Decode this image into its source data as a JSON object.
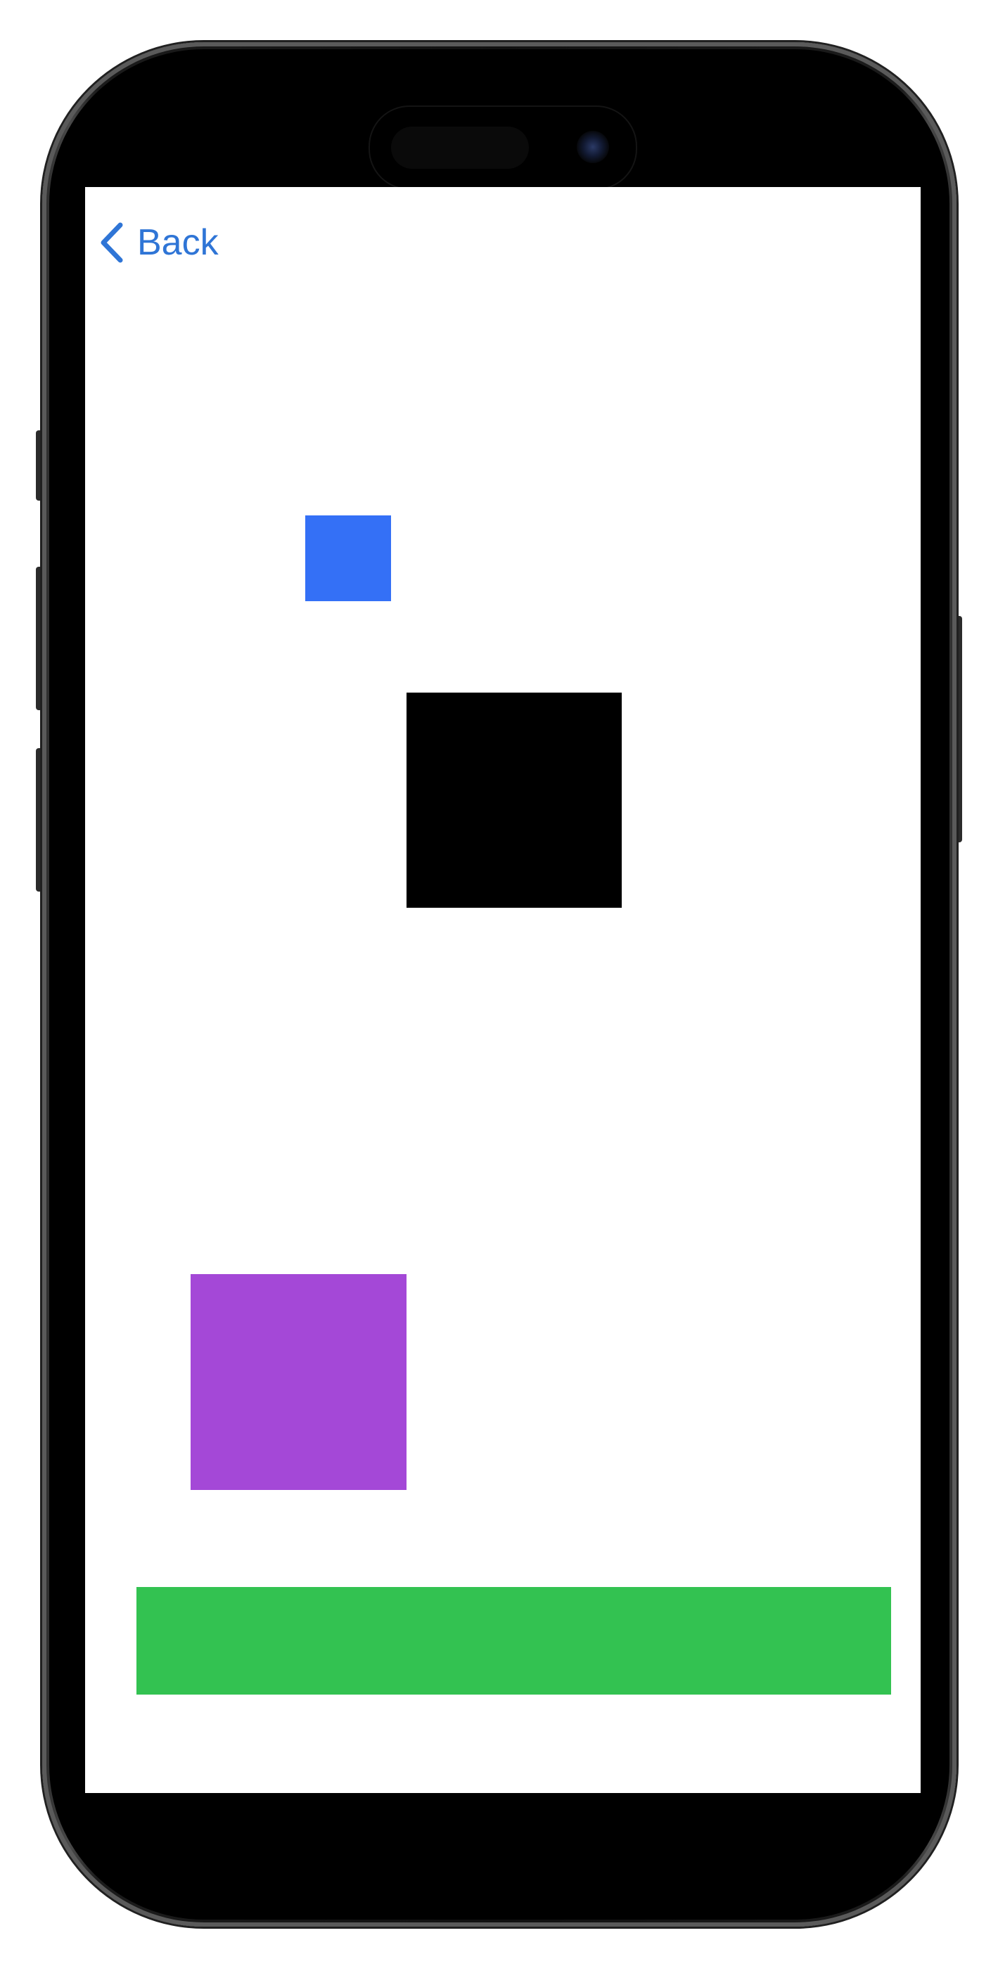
{
  "navigation": {
    "back_label": "Back",
    "back_icon": "chevron-left-icon"
  },
  "colors": {
    "accent": "#2f75d6",
    "blue_square": "#3470f6",
    "black_square": "#000000",
    "purple_square": "#a448d7",
    "green_bar": "#33c251",
    "screen_background": "#ffffff"
  },
  "shapes": [
    {
      "name": "blue-square",
      "color": "#3470f6"
    },
    {
      "name": "black-square",
      "color": "#000000"
    },
    {
      "name": "purple-square",
      "color": "#a448d7"
    },
    {
      "name": "green-bar",
      "color": "#33c251"
    }
  ]
}
